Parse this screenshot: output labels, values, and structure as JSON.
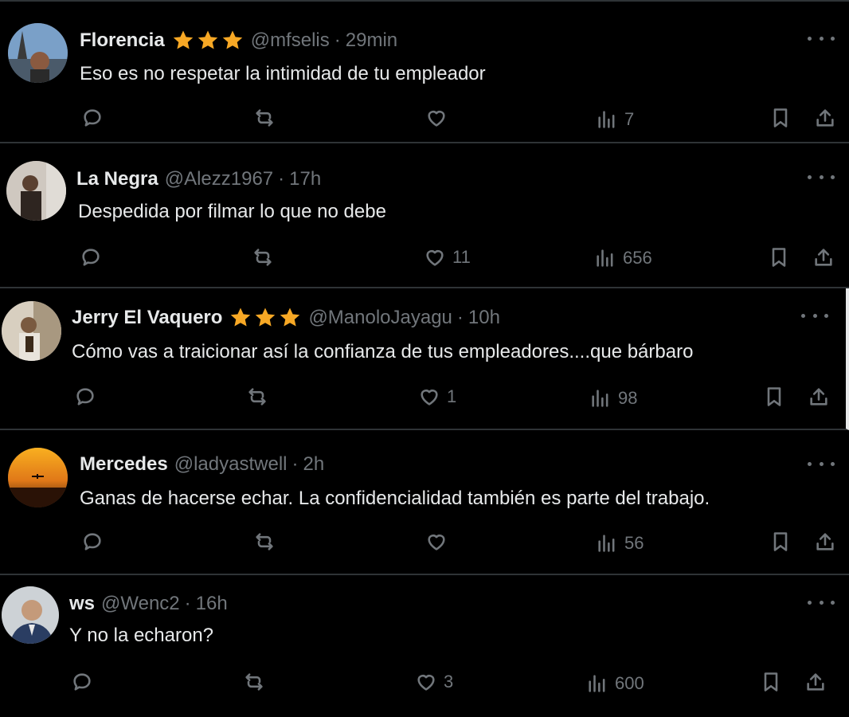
{
  "tweets": [
    {
      "name": "Florencia",
      "stars": 3,
      "handle": "@mfselis",
      "time": "29min",
      "text": "Eso es no respetar la intimidad de tu empleador",
      "replies": "",
      "retweets": "",
      "likes": "",
      "views": "7",
      "avatar_colors": [
        "#6a8db5",
        "#3a4a5c"
      ]
    },
    {
      "name": "La Negra",
      "stars": 0,
      "handle": "@Alezz1967",
      "time": "17h",
      "text": "Despedida por filmar lo que no debe",
      "replies": "",
      "retweets": "",
      "likes": "11",
      "views": "656",
      "avatar_colors": [
        "#c9c4be",
        "#5a4a40"
      ]
    },
    {
      "name": "Jerry El Vaquero",
      "stars": 3,
      "handle": "@ManoloJayagu",
      "time": "10h",
      "text": "Cómo vas a traicionar así la confianza de tus empleadores....que bárbaro",
      "replies": "",
      "retweets": "",
      "likes": "1",
      "views": "98",
      "avatar_colors": [
        "#b8a888",
        "#3c3226"
      ]
    },
    {
      "name": "Mercedes",
      "stars": 0,
      "handle": "@ladyastwell",
      "time": "2h",
      "text": "Ganas de hacerse echar. La confidencialidad también es parte del trabajo.",
      "replies": "",
      "retweets": "",
      "likes": "",
      "views": "56",
      "avatar_colors": [
        "#f0a020",
        "#7a3a10"
      ]
    },
    {
      "name": "ws",
      "stars": 0,
      "handle": "@Wenc2",
      "time": "16h",
      "text": "Y no la echaron?",
      "replies": "",
      "retweets": "",
      "likes": "3",
      "views": "600",
      "avatar_colors": [
        "#c8cdd2",
        "#2a3a5a"
      ]
    }
  ],
  "separator": "·",
  "colors": {
    "background": "#000000",
    "text": "#e7e9ea",
    "muted": "#71767b",
    "star": "#f7a825",
    "divider": "#2f3336"
  },
  "icons": [
    "reply-icon",
    "retweet-icon",
    "like-icon",
    "views-icon",
    "bookmark-icon",
    "share-icon",
    "more-icon",
    "star-icon"
  ]
}
